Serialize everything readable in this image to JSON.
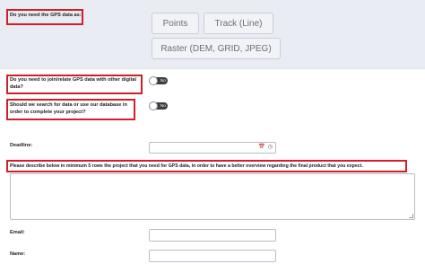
{
  "gps_question": {
    "label": "Do you need the GPS data as:"
  },
  "data_type_options": [
    "Points",
    "Track (Line)",
    "Raster (DEM, GRID, JPEG)"
  ],
  "join_question": {
    "line1": "Do you need to join/relate GPS data with other digital",
    "line2": "data?",
    "toggle_label": "No"
  },
  "search_question": {
    "line1": "Should we search for data or use our database in",
    "line2": "order to complete your project?",
    "toggle_label": "No"
  },
  "deadline": {
    "label": "Deadline:",
    "value": "",
    "calendar_icon": "calendar-icon",
    "clock_icon": "clock-icon"
  },
  "description": {
    "label": "Please describe below in minimum 5 rows the project that you need for GPS data, in order to have a better overview regarding the final product that you expect.",
    "value": ""
  },
  "email": {
    "label": "Email:",
    "value": ""
  },
  "name": {
    "label": "Name:",
    "value": ""
  },
  "colors": {
    "highlight": "#d11f2a",
    "band": "#e9edf3",
    "toggle": "#3c3f44"
  }
}
